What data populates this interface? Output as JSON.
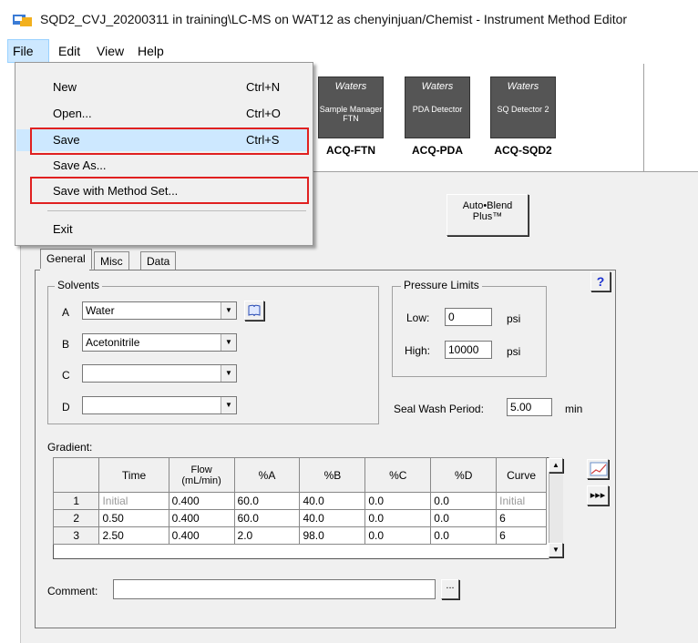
{
  "window": {
    "title": "SQD2_CVJ_20200311 in training\\LC-MS on WAT12 as chenyinjuan/Chemist - Instrument Method Editor"
  },
  "menubar": {
    "items": [
      "File",
      "Edit",
      "View",
      "Help"
    ]
  },
  "file_menu": {
    "items": [
      {
        "label": "New",
        "shortcut": "Ctrl+N"
      },
      {
        "label": "Open...",
        "shortcut": "Ctrl+O"
      },
      {
        "label": "Save",
        "shortcut": "Ctrl+S"
      },
      {
        "label": "Save As...",
        "shortcut": ""
      },
      {
        "label": "Save with Method Set...",
        "shortcut": ""
      },
      {
        "label": "Exit",
        "shortcut": ""
      }
    ],
    "highlighted_index": 2
  },
  "modules": [
    {
      "brand": "Waters",
      "caption": "Sample Manager FTN",
      "label": "ACQ-FTN"
    },
    {
      "brand": "Waters",
      "caption": "PDA Detector",
      "label": "ACQ-PDA"
    },
    {
      "brand": "Waters",
      "caption": "SQ Detector 2",
      "label": "ACQ-SQD2"
    }
  ],
  "autoblend": {
    "line1": "Auto•Blend",
    "line2": "Plus™"
  },
  "tabs": [
    "General",
    "Misc",
    "Data"
  ],
  "help_button": "?",
  "solvents": {
    "title": "Solvents",
    "rows": [
      {
        "letter": "A",
        "value": "Water"
      },
      {
        "letter": "B",
        "value": "Acetonitrile"
      },
      {
        "letter": "C",
        "value": ""
      },
      {
        "letter": "D",
        "value": ""
      }
    ]
  },
  "pressure": {
    "title": "Pressure Limits",
    "low_label": "Low:",
    "low_value": "0",
    "high_label": "High:",
    "high_value": "10000",
    "unit": "psi"
  },
  "seal_wash": {
    "label": "Seal Wash Period:",
    "value": "5.00",
    "unit": "min"
  },
  "gradient": {
    "label": "Gradient:",
    "headers": [
      "",
      "Time",
      "Flow\n(mL/min)",
      "%A",
      "%B",
      "%C",
      "%D",
      "Curve"
    ],
    "flow_line1": "Flow",
    "flow_line2": "(mL/min)",
    "rows": [
      [
        "1",
        "Initial",
        "0.400",
        "60.0",
        "40.0",
        "0.0",
        "0.0",
        "Initial"
      ],
      [
        "2",
        "0.50",
        "0.400",
        "60.0",
        "40.0",
        "0.0",
        "0.0",
        "6"
      ],
      [
        "3",
        "2.50",
        "0.400",
        "2.0",
        "98.0",
        "0.0",
        "0.0",
        "6"
      ]
    ]
  },
  "comment": {
    "label": "Comment:",
    "value": "",
    "browse": "..."
  },
  "icons": {
    "app_icon": "instrument-method-icon",
    "graph_icon": "gradient-graph-icon",
    "fast_forward_icon": "fast-forward-icon",
    "book_icon": "solvent-library-icon"
  },
  "colors": {
    "highlight": "#cde8ff",
    "callout": "#e02020"
  }
}
